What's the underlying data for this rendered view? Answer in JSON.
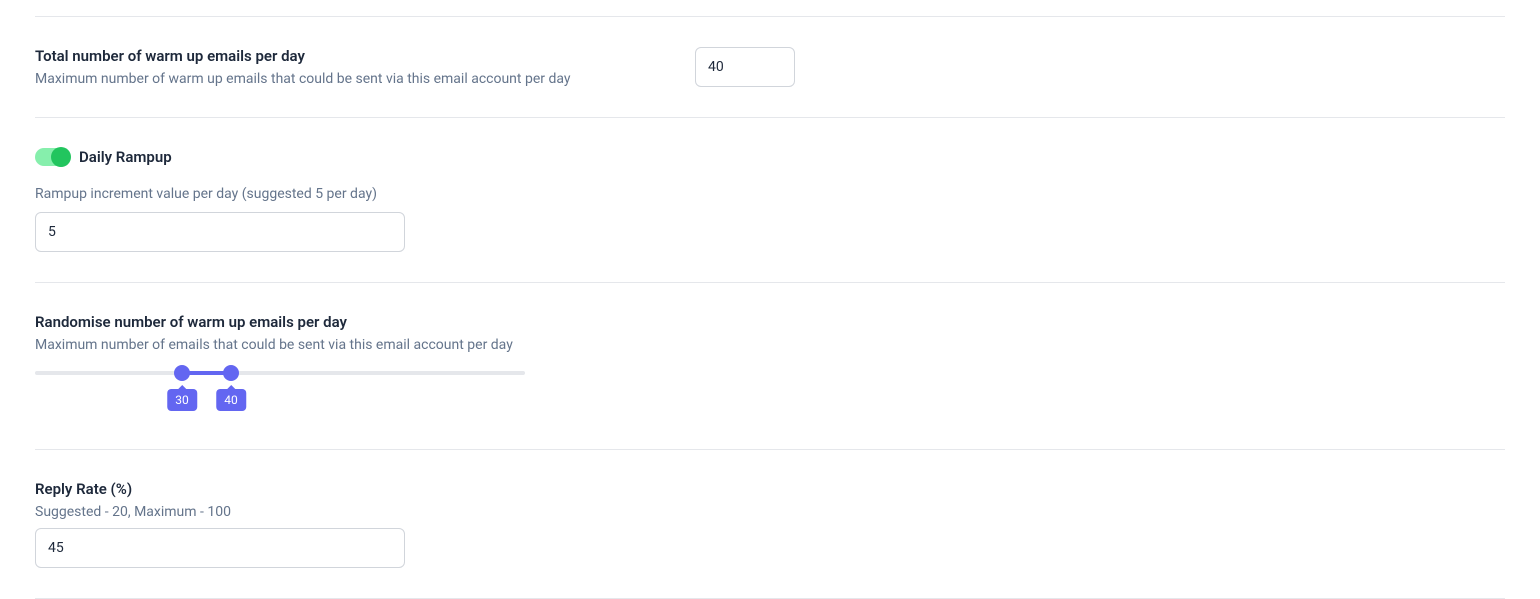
{
  "total_emails": {
    "title": "Total number of warm up emails per day",
    "desc": "Maximum number of warm up emails that could be sent via this email account per day",
    "value": "40"
  },
  "daily_rampup": {
    "toggle_on": true,
    "label": "Daily Rampup",
    "increment_label": "Rampup increment value per day (suggested 5 per day)",
    "increment_value": "5"
  },
  "randomise": {
    "title": "Randomise number of warm up emails per day",
    "desc": "Maximum number of emails that could be sent via this email account per day",
    "min": 0,
    "max": 100,
    "low": 30,
    "high": 40,
    "low_label": "30",
    "high_label": "40"
  },
  "reply_rate": {
    "title": "Reply Rate (%)",
    "desc": "Suggested - 20, Maximum - 100",
    "value": "45"
  }
}
